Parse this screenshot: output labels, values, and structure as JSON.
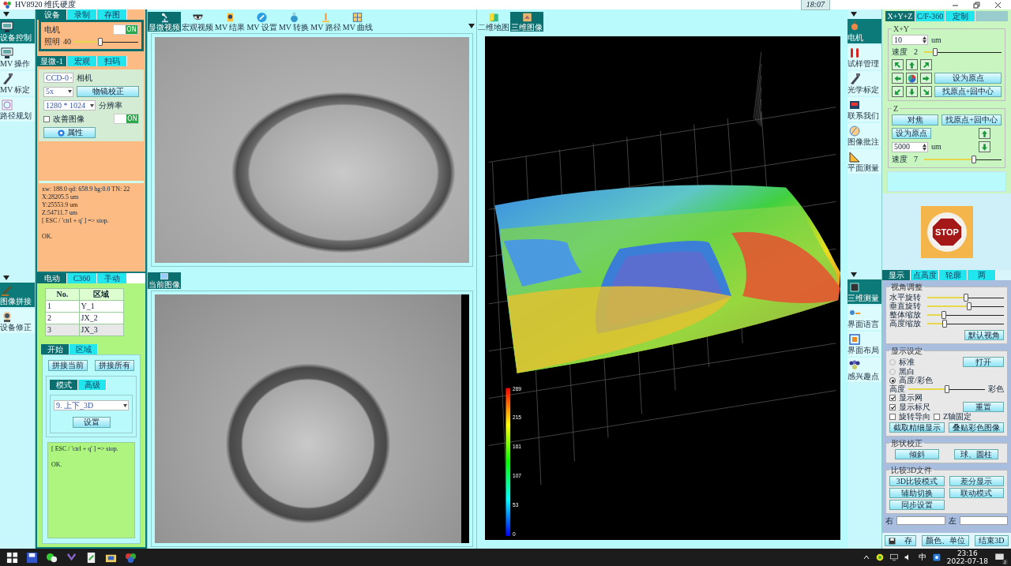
{
  "title_bar": {
    "title": "HV8920 维氏硬度",
    "clock": "18:07"
  },
  "left_nav_top": [
    {
      "label": "设备控制",
      "selected": true
    },
    {
      "label": "MV 操作",
      "selected": false
    },
    {
      "label": "MV 标定",
      "selected": false
    },
    {
      "label": "路径规划",
      "selected": false
    }
  ],
  "device_tabs": [
    {
      "label": "设备",
      "selected": true
    },
    {
      "label": "录制",
      "selected": false
    },
    {
      "label": "存图",
      "selected": false
    }
  ],
  "device": {
    "motor_label": "电机",
    "motor_switch": {
      "text": "ON",
      "on": true
    },
    "light": {
      "label": "照明",
      "value": "40",
      "level": 0.4
    }
  },
  "camera_tabs": [
    {
      "label": "显微-1",
      "selected": true
    },
    {
      "label": "宏观",
      "selected": false
    },
    {
      "label": "扫码",
      "selected": false
    }
  ],
  "camera": {
    "camera_select": "CCD-0",
    "camera_label": "相机",
    "lens_select": "5x",
    "calibrate_button": "物镜校正",
    "resolution_select": "1280 * 1024",
    "resolution_label": "分辨率",
    "enhance": {
      "label": "改善图像",
      "checked": false
    },
    "enhance_switch": {
      "text": "ON",
      "on": true
    },
    "properties_button": "属性"
  },
  "log_top": {
    "lines": [
      "xw: 188.0 qd: 658.9 hg:0.0 TN: 22",
      "X:28205.5 um",
      "Y:25553.9 um",
      "Z:54711.7 um",
      "[ ESC / 'ctrl + q' ] => stop."
    ],
    "status": "OK."
  },
  "left_nav_bottom": [
    {
      "label": "图像拼接",
      "selected": true
    },
    {
      "label": "设备修正",
      "selected": false
    }
  ],
  "stitch_tabs": [
    {
      "label": "电动",
      "selected": true
    },
    {
      "label": "C360",
      "selected": false
    },
    {
      "label": "手动",
      "selected": false
    }
  ],
  "region_table": {
    "columns": [
      "No.",
      "区域"
    ],
    "rows": [
      {
        "cells": [
          "1",
          "Y_1"
        ],
        "selected": false
      },
      {
        "cells": [
          "2",
          "JX_2"
        ],
        "selected": false
      },
      {
        "cells": [
          "3",
          "JX_3"
        ],
        "selected": true
      }
    ]
  },
  "stitch_subtabs": [
    {
      "label": "开始",
      "selected": true
    },
    {
      "label": "区域",
      "selected": false
    }
  ],
  "stitch_buttons": [
    "拼接当前",
    "拼接所有"
  ],
  "mode_tabs": [
    {
      "label": "模式",
      "selected": true
    },
    {
      "label": "高级",
      "selected": false
    }
  ],
  "mode_select": "9. 上下_3D",
  "set_button": "设置",
  "log_bottom": {
    "lines": [
      "[ ESC / 'ctrl + q' ] => stop."
    ],
    "status": "OK."
  },
  "image_toolbar": [
    {
      "label": "显微视频",
      "selected": true
    },
    {
      "label": "宏观视频",
      "selected": false
    },
    {
      "label": "MV 结果",
      "selected": false
    },
    {
      "label": "MV 设置",
      "selected": false
    },
    {
      "label": "MV 转换",
      "selected": false
    },
    {
      "label": "MV 路径",
      "selected": false
    },
    {
      "label": "MV 曲线",
      "selected": false
    }
  ],
  "image_tab": {
    "label": "当前图像",
    "selected": true
  },
  "view_tabs": [
    {
      "label": "二维地图",
      "selected": false
    },
    {
      "label": "三维图像",
      "selected": true
    }
  ],
  "colorbar_ticks": [
    "269",
    "215",
    "161",
    "107",
    "53",
    "0"
  ],
  "right_nav_top": [
    {
      "label": "电机",
      "selected": true
    },
    {
      "label": "试样管理",
      "selected": false
    },
    {
      "label": "光学标定",
      "selected": false
    },
    {
      "label": "联系我们",
      "selected": false
    },
    {
      "label": "图像批注",
      "selected": false
    },
    {
      "label": "平面测量",
      "selected": false
    }
  ],
  "motion_tabs": [
    {
      "label": "X+Y+Z",
      "selected": true
    },
    {
      "label": "C/F-360",
      "selected": false
    },
    {
      "label": "定制",
      "selected": false
    }
  ],
  "xy_group": {
    "title": "X+Y",
    "step": "10",
    "unit": "um",
    "speed": {
      "label": "速度",
      "value": "2",
      "level": 0.12
    },
    "set_origin_button": "设为原点",
    "find_origin_button": "找原点+回中心"
  },
  "z_group": {
    "title": "Z",
    "focus_button": "对焦",
    "find_origin_button": "找原点+回中心",
    "set_origin_button": "设为原点",
    "step": "5000",
    "unit": "um",
    "speed": {
      "label": "速度",
      "value": "7",
      "level": 0.65
    }
  },
  "stop_sign": "STOP",
  "right_nav_bottom": [
    {
      "label": "三维测量",
      "selected": true
    },
    {
      "label": "界面语言",
      "selected": false
    },
    {
      "label": "界面布局",
      "selected": false
    },
    {
      "label": "感兴趣点",
      "selected": false
    }
  ],
  "view3d_tabs": [
    {
      "label": "显示",
      "selected": true
    },
    {
      "label": "点高度",
      "selected": false
    },
    {
      "label": "轮廓",
      "selected": false
    },
    {
      "label": "两",
      "selected": false
    }
  ],
  "view_adjust": {
    "title": "视角调整",
    "sliders": [
      {
        "label": "水平旋转",
        "level": 0.5
      },
      {
        "label": "垂直旋转",
        "level": 0.55
      },
      {
        "label": "整体缩放",
        "level": 0.2
      },
      {
        "label": "高度缩放",
        "level": 0.21
      }
    ],
    "button": "默认视角"
  },
  "display_settings": {
    "title": "显示设定",
    "modes": [
      {
        "label": "标准",
        "selected": false
      },
      {
        "label": "黑白",
        "selected": false
      },
      {
        "label": "高度/彩色",
        "selected": true
      }
    ],
    "open_button": "打开",
    "blend": {
      "left_label": "高度",
      "right_label": "彩色",
      "level": 0.5
    },
    "options": [
      {
        "label": "显示网",
        "checked": true
      },
      {
        "label": "显示标尺",
        "checked": true
      }
    ],
    "reset_button": "重置",
    "extra_options": [
      {
        "label": "旋转导向",
        "checked": false
      },
      {
        "label": "Z轴固定",
        "checked": false
      }
    ],
    "buttons": [
      "截取精细显示",
      "叠贴彩色图像"
    ]
  },
  "shape_correction": {
    "title": "形状校正",
    "buttons": [
      "倾斜",
      "球、圆柱"
    ]
  },
  "compare_files": {
    "title": "比较3D文件",
    "buttons": [
      "3D比较模式",
      "差分显示",
      "辅助切换",
      "联动模式",
      "同步设置"
    ],
    "right_label": "右",
    "left_label": "左"
  },
  "bottom_buttons": [
    "存",
    "颜色、单位",
    "结束3D"
  ],
  "taskbar": {
    "ime": "中",
    "time": "23:16",
    "date": "2022-07-18",
    "notifications": "2"
  }
}
